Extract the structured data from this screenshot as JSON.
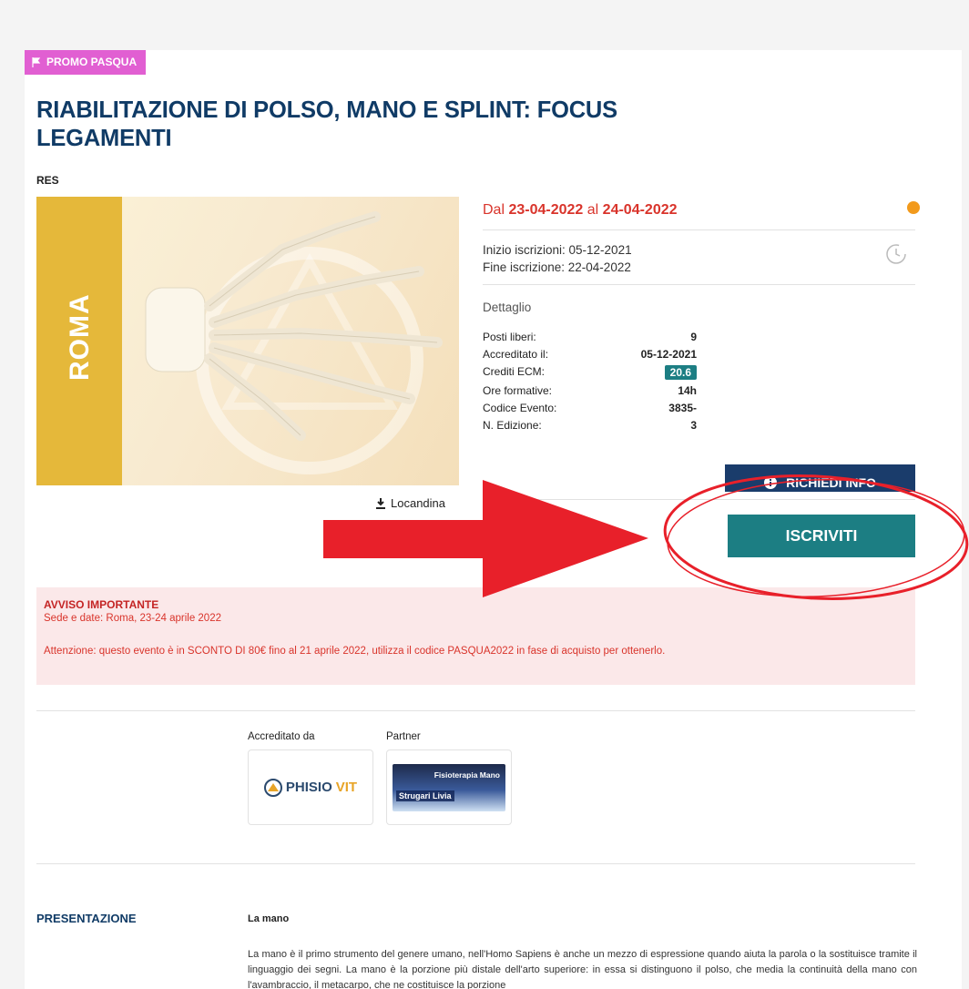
{
  "promo_badge": "PROMO PASQUA",
  "title": "RIABILITAZIONE DI POLSO, MANO E SPLINT: FOCUS LEGAMENTI",
  "type": "RES",
  "hero": {
    "city": "ROMA"
  },
  "locandina_label": "Locandina",
  "dates": {
    "prefix": "Dal",
    "start": "23-04-2022",
    "mid": "al",
    "end": "24-04-2022"
  },
  "registration": {
    "start": "Inizio iscrizioni: 05-12-2021",
    "end": "Fine iscrizione: 22-04-2022"
  },
  "detail": {
    "heading": "Dettaglio",
    "rows": [
      {
        "label": "Posti liberi:",
        "value": "9"
      },
      {
        "label": "Accreditato il:",
        "value": "05-12-2021"
      },
      {
        "label": "Crediti ECM:",
        "value": "20.6"
      },
      {
        "label": "Ore formative:",
        "value": "14h"
      },
      {
        "label": "Codice Evento:",
        "value": "3835-"
      },
      {
        "label": "N. Edizione:",
        "value": "3"
      }
    ]
  },
  "buttons": {
    "info": "RICHIEDI INFO",
    "subscribe": "ISCRIVITI"
  },
  "notice": {
    "heading": "AVVISO IMPORTANTE",
    "line1": "Sede e date: Roma, 23-24 aprile 2022",
    "line2": "Attenzione: questo evento è in SCONTO DI 80€ fino al 21 aprile 2022, utilizza il codice PASQUA2022 in fase di acquisto per ottenerlo."
  },
  "accredited_label": "Accreditato da",
  "partner_label": "Partner",
  "accreditor_logo": {
    "a": "PHISIO",
    "b": "VIT"
  },
  "partner_logo": {
    "line1": "Fisioterapia Mano",
    "line2": "Strugari Livia"
  },
  "presentation": {
    "heading": "PRESENTAZIONE",
    "subheading": "La mano",
    "body": "La mano è il primo strumento del genere umano, nell'Homo Sapiens è anche un mezzo di espressione quando aiuta la parola o la sostituisce tramite il linguaggio dei segni. La mano è la porzione più distale dell'arto superiore: in essa si distinguono il polso, che media la continuità della mano con l'avambraccio, il metacarpo, che ne costituisce la porzione"
  },
  "colors": {
    "title": "#103b66",
    "promo": "#e15fd2",
    "accent_red": "#d9342b",
    "teal": "#1c7e83",
    "navy_button": "#1a3c6b",
    "hero_band": "#e5b83a",
    "status_dot": "#f29a1c",
    "annotation_red": "#e8202a"
  }
}
